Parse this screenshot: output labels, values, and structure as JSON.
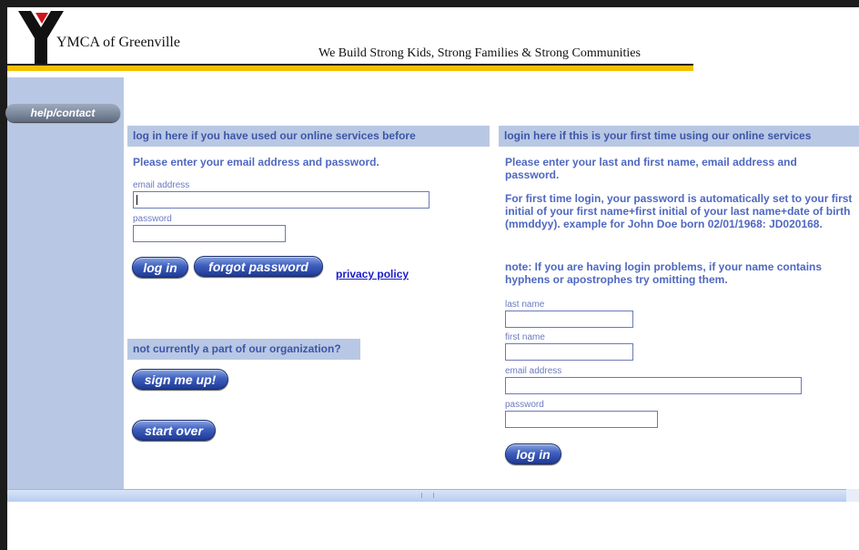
{
  "header": {
    "org_name": "YMCA of Greenville",
    "tagline": "We Build Strong Kids, Strong Families & Strong Communities",
    "logo_icon": "ymca-y-logo-icon"
  },
  "sidebar": {
    "help_label": "help/contact"
  },
  "login": {
    "section_title": "log in here if you have used our online services before",
    "instructions": "Please enter your email address and password.",
    "email_label": "email address",
    "email_value": "",
    "password_label": "password",
    "password_value": "",
    "login_button": "log in",
    "forgot_button": "forgot password",
    "privacy_link": "privacy policy"
  },
  "signup": {
    "question": "not currently a part of our organization?",
    "signup_button": "sign me up!",
    "start_over_button": "start over"
  },
  "first_time": {
    "section_title": "login here if this is your first time using our online services",
    "instructions": "Please enter your last and first name, email address and password.",
    "password_note": "For first time login, your password is automatically set to your first initial of your first name+first initial of your last name+date of birth (mmddyy). example for John Doe born 02/01/1968: JD020168.",
    "problem_note": "note: If you are having login problems, if your name contains hyphens or apostrophes try omitting them.",
    "last_name_label": "last name",
    "first_name_label": "first name",
    "email_label": "email address",
    "password_label": "password",
    "login_button": "log in"
  },
  "colors": {
    "accent_bar": "#b8c8e4",
    "heading_text": "#3d55a8",
    "body_blue": "#4f68c0",
    "gold_rule": "#f4c000",
    "button_blue": "#2f4fb0"
  }
}
